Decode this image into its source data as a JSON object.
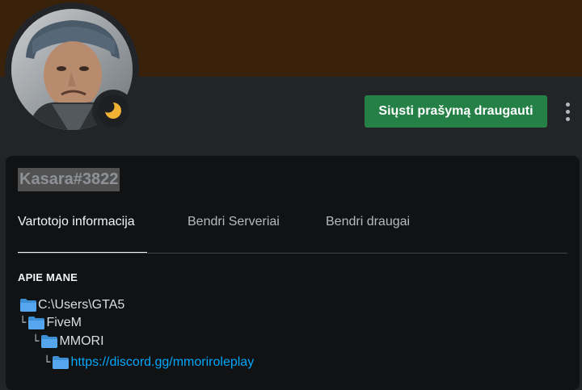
{
  "profile": {
    "username": "Kasara#3822",
    "status_icon": "moon-idle-icon",
    "banner_color": "#3a2109"
  },
  "actions": {
    "add_friend_label": "Siųsti prašymą draugauti",
    "more_icon": "vertical-ellipsis-icon"
  },
  "tabs": [
    {
      "label": "Vartotojo informacija",
      "active": true
    },
    {
      "label": "Bendri Serveriai",
      "active": false
    },
    {
      "label": "Bendri draugai",
      "active": false
    }
  ],
  "about": {
    "title": "APIE MANE",
    "lines": [
      {
        "prefix": "",
        "icon": "folder-icon",
        "text": "C:\\Users\\GTA5"
      },
      {
        "prefix": "└",
        "icon": "folder-icon",
        "text": "FiveM"
      },
      {
        "prefix": "└",
        "icon": "folder-icon",
        "text": "MMORI"
      },
      {
        "prefix": "└",
        "icon": "folder-icon",
        "text": "https://discord.gg/mmoriroleplay"
      }
    ]
  }
}
